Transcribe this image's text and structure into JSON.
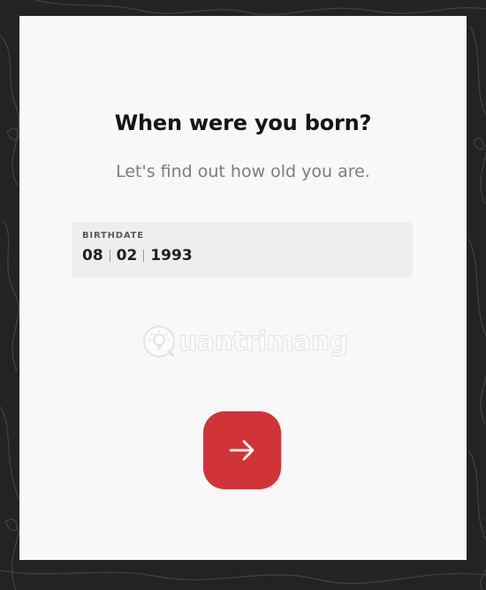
{
  "page": {
    "title": "When were you born?",
    "subtitle": "Let's find out how old you are."
  },
  "birthdate": {
    "label": "BIRTHDATE",
    "month": "08",
    "day": "02",
    "year": "1993"
  },
  "watermark": {
    "text": "uantrimang",
    "icon": "lightbulb-logo-icon"
  },
  "next_button": {
    "icon": "arrow-right-icon",
    "color": "#d13438"
  },
  "colors": {
    "background": "#232323",
    "card": "#f8f8f8",
    "field": "#eeeeee",
    "accent": "#d13438"
  }
}
